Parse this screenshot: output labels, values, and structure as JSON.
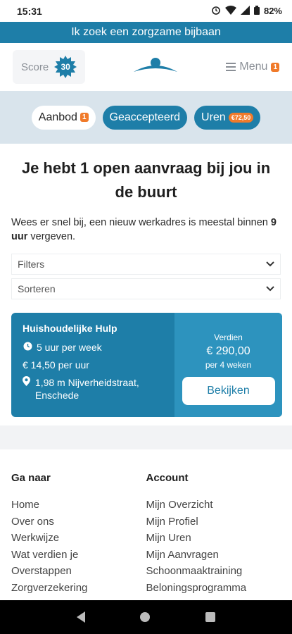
{
  "status": {
    "time": "15:31",
    "battery": "82%"
  },
  "banner": "Ik zoek een zorgzame bijbaan",
  "header": {
    "score_label": "Score",
    "score_value": "30",
    "menu_label": "Menu",
    "menu_count": "1"
  },
  "tabs": [
    {
      "label": "Aanbod",
      "badge": "1"
    },
    {
      "label": "Geaccepteerd"
    },
    {
      "label": "Uren",
      "badge": "€72,50"
    }
  ],
  "main": {
    "title": "Je hebt 1 open aanvraag bij jou in de buurt",
    "intro_pre": "Wees er snel bij, een nieuw werkadres is meestal binnen ",
    "intro_bold": "9 uur",
    "intro_post": " vergeven.",
    "filters": "Filters",
    "sort": "Sorteren"
  },
  "job": {
    "title": "Huishoudelijke Hulp",
    "hours": "5 uur per week",
    "rate": "€ 14,50 per uur",
    "location": "1,98 m Nijverheidstraat, Enschede",
    "earn_label": "Verdien",
    "earn_amount": "€ 290,00",
    "earn_period": "per 4 weken",
    "view_button": "Bekijken"
  },
  "footer": {
    "col1_title": "Ga naar",
    "col1_links": [
      "Home",
      "Over ons",
      "Werkwijze",
      "Wat verdien je",
      "Overstappen",
      "Zorgverzekering"
    ],
    "col2_title": "Account",
    "col2_links": [
      "Mijn Overzicht",
      "Mijn Profiel",
      "Mijn Uren",
      "Mijn Aanvragen",
      "Schoonmaaktraining",
      "Beloningsprogramma"
    ]
  },
  "colors": {
    "brand": "#1e7ea8",
    "accent": "#f07a2a",
    "tabs_bg": "#d9e4ec"
  },
  "icons": {
    "clock": "clock-icon",
    "euro": "euro-icon",
    "pin": "location-pin-icon",
    "menu": "hamburger-icon"
  }
}
